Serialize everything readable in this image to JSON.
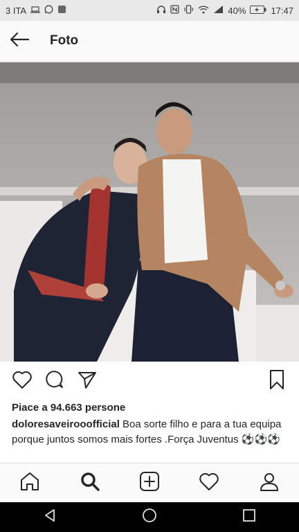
{
  "status_bar": {
    "carrier": "3 ITA",
    "battery": "40%",
    "time": "17:47"
  },
  "header": {
    "title": "Foto"
  },
  "post": {
    "likes_text": "Piace a 94.663 persone",
    "username": "doloresaveirooofficial",
    "caption": "Boa sorte filho e para a tua equipa porque juntos somos mais fortes .Força Juventus ⚽⚽⚽"
  },
  "icons": {
    "back": "arrow-left-icon",
    "like": "heart-icon",
    "comment": "comment-icon",
    "share": "send-icon",
    "save": "bookmark-icon",
    "home": "home-icon",
    "search": "search-icon",
    "add": "add-post-icon",
    "activity": "heart-icon",
    "profile": "profile-icon"
  },
  "colors": {
    "text": "#262626",
    "appbar_bg": "#fafafa"
  }
}
